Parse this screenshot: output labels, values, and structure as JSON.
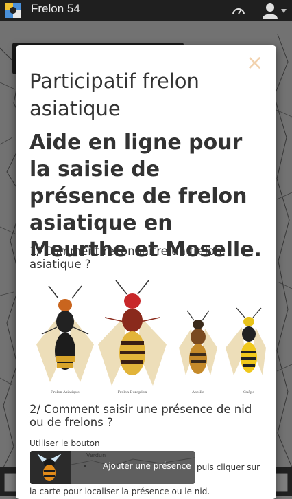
{
  "app": {
    "title": "Frelon 54",
    "icons": [
      "app-logo",
      "dashboard-icon",
      "user-icon",
      "caret-down-icon"
    ]
  },
  "modal": {
    "close_symbol": "×",
    "title": "Participatif frelon asiatique",
    "heading": "Aide en ligne pour la saisie de présence de frelon asiatique en Meurthe et Moselle.",
    "section1": "1/ Comment reconnaître un frelon asiatique ?",
    "insects": [
      {
        "caption": "Frelon Asiatique"
      },
      {
        "caption": "Frelon Européen"
      },
      {
        "caption": "Abeille"
      },
      {
        "caption": "Guêpe"
      }
    ],
    "section2": "2/ Comment saisir une présence de nid ou de frelons ?",
    "para_a": "Utiliser le bouton",
    "add_button_label": "Ajouter une présence",
    "map_city": "Verdun",
    "para_b": "puis cliquer sur",
    "para_c": "la carte pour localiser la présence ou le nid."
  },
  "colors": {
    "topbar": "#1f1f1f",
    "close": "#f2d2ae",
    "text": "#333333",
    "button": "#2b2b2b"
  }
}
